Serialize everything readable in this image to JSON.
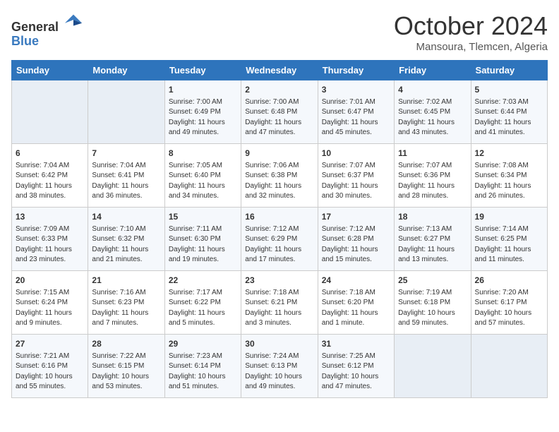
{
  "header": {
    "logo_general": "General",
    "logo_blue": "Blue",
    "month_title": "October 2024",
    "location": "Mansoura, Tlemcen, Algeria"
  },
  "days_of_week": [
    "Sunday",
    "Monday",
    "Tuesday",
    "Wednesday",
    "Thursday",
    "Friday",
    "Saturday"
  ],
  "weeks": [
    [
      {
        "day": "",
        "info": ""
      },
      {
        "day": "",
        "info": ""
      },
      {
        "day": "1",
        "info": "Sunrise: 7:00 AM\nSunset: 6:49 PM\nDaylight: 11 hours and 49 minutes."
      },
      {
        "day": "2",
        "info": "Sunrise: 7:00 AM\nSunset: 6:48 PM\nDaylight: 11 hours and 47 minutes."
      },
      {
        "day": "3",
        "info": "Sunrise: 7:01 AM\nSunset: 6:47 PM\nDaylight: 11 hours and 45 minutes."
      },
      {
        "day": "4",
        "info": "Sunrise: 7:02 AM\nSunset: 6:45 PM\nDaylight: 11 hours and 43 minutes."
      },
      {
        "day": "5",
        "info": "Sunrise: 7:03 AM\nSunset: 6:44 PM\nDaylight: 11 hours and 41 minutes."
      }
    ],
    [
      {
        "day": "6",
        "info": "Sunrise: 7:04 AM\nSunset: 6:42 PM\nDaylight: 11 hours and 38 minutes."
      },
      {
        "day": "7",
        "info": "Sunrise: 7:04 AM\nSunset: 6:41 PM\nDaylight: 11 hours and 36 minutes."
      },
      {
        "day": "8",
        "info": "Sunrise: 7:05 AM\nSunset: 6:40 PM\nDaylight: 11 hours and 34 minutes."
      },
      {
        "day": "9",
        "info": "Sunrise: 7:06 AM\nSunset: 6:38 PM\nDaylight: 11 hours and 32 minutes."
      },
      {
        "day": "10",
        "info": "Sunrise: 7:07 AM\nSunset: 6:37 PM\nDaylight: 11 hours and 30 minutes."
      },
      {
        "day": "11",
        "info": "Sunrise: 7:07 AM\nSunset: 6:36 PM\nDaylight: 11 hours and 28 minutes."
      },
      {
        "day": "12",
        "info": "Sunrise: 7:08 AM\nSunset: 6:34 PM\nDaylight: 11 hours and 26 minutes."
      }
    ],
    [
      {
        "day": "13",
        "info": "Sunrise: 7:09 AM\nSunset: 6:33 PM\nDaylight: 11 hours and 23 minutes."
      },
      {
        "day": "14",
        "info": "Sunrise: 7:10 AM\nSunset: 6:32 PM\nDaylight: 11 hours and 21 minutes."
      },
      {
        "day": "15",
        "info": "Sunrise: 7:11 AM\nSunset: 6:30 PM\nDaylight: 11 hours and 19 minutes."
      },
      {
        "day": "16",
        "info": "Sunrise: 7:12 AM\nSunset: 6:29 PM\nDaylight: 11 hours and 17 minutes."
      },
      {
        "day": "17",
        "info": "Sunrise: 7:12 AM\nSunset: 6:28 PM\nDaylight: 11 hours and 15 minutes."
      },
      {
        "day": "18",
        "info": "Sunrise: 7:13 AM\nSunset: 6:27 PM\nDaylight: 11 hours and 13 minutes."
      },
      {
        "day": "19",
        "info": "Sunrise: 7:14 AM\nSunset: 6:25 PM\nDaylight: 11 hours and 11 minutes."
      }
    ],
    [
      {
        "day": "20",
        "info": "Sunrise: 7:15 AM\nSunset: 6:24 PM\nDaylight: 11 hours and 9 minutes."
      },
      {
        "day": "21",
        "info": "Sunrise: 7:16 AM\nSunset: 6:23 PM\nDaylight: 11 hours and 7 minutes."
      },
      {
        "day": "22",
        "info": "Sunrise: 7:17 AM\nSunset: 6:22 PM\nDaylight: 11 hours and 5 minutes."
      },
      {
        "day": "23",
        "info": "Sunrise: 7:18 AM\nSunset: 6:21 PM\nDaylight: 11 hours and 3 minutes."
      },
      {
        "day": "24",
        "info": "Sunrise: 7:18 AM\nSunset: 6:20 PM\nDaylight: 11 hours and 1 minute."
      },
      {
        "day": "25",
        "info": "Sunrise: 7:19 AM\nSunset: 6:18 PM\nDaylight: 10 hours and 59 minutes."
      },
      {
        "day": "26",
        "info": "Sunrise: 7:20 AM\nSunset: 6:17 PM\nDaylight: 10 hours and 57 minutes."
      }
    ],
    [
      {
        "day": "27",
        "info": "Sunrise: 7:21 AM\nSunset: 6:16 PM\nDaylight: 10 hours and 55 minutes."
      },
      {
        "day": "28",
        "info": "Sunrise: 7:22 AM\nSunset: 6:15 PM\nDaylight: 10 hours and 53 minutes."
      },
      {
        "day": "29",
        "info": "Sunrise: 7:23 AM\nSunset: 6:14 PM\nDaylight: 10 hours and 51 minutes."
      },
      {
        "day": "30",
        "info": "Sunrise: 7:24 AM\nSunset: 6:13 PM\nDaylight: 10 hours and 49 minutes."
      },
      {
        "day": "31",
        "info": "Sunrise: 7:25 AM\nSunset: 6:12 PM\nDaylight: 10 hours and 47 minutes."
      },
      {
        "day": "",
        "info": ""
      },
      {
        "day": "",
        "info": ""
      }
    ]
  ]
}
